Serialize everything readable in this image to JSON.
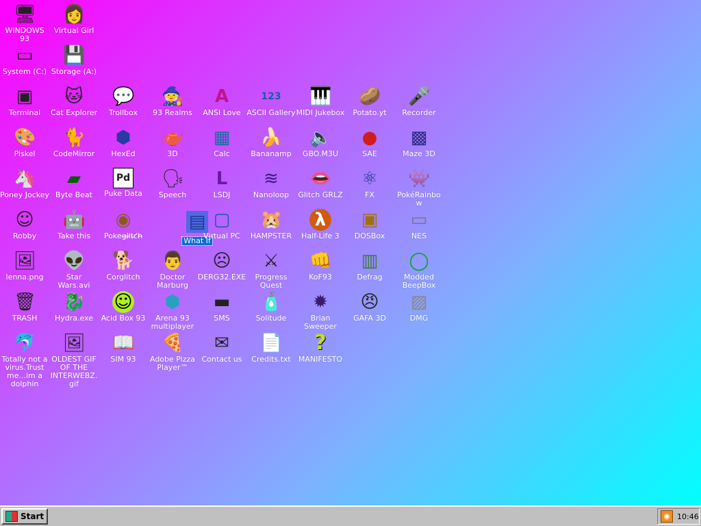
{
  "desktop": {
    "icons": [
      {
        "id": "windows93",
        "label": "WINDOWS 93",
        "glyph": "🖥"
      },
      {
        "id": "virtual-girl",
        "label": "Virtual Girl",
        "glyph": "👩"
      },
      {
        "id": "system-c",
        "label": "System (C:)",
        "glyph": "▭"
      },
      {
        "id": "storage-a",
        "label": "Storage (A:)",
        "glyph": "💾"
      },
      {
        "id": "terminal",
        "label": "Terminal",
        "glyph": "▣"
      },
      {
        "id": "cat-explorer",
        "label": "Cat Explorer",
        "glyph": "🐱"
      },
      {
        "id": "trollbox",
        "label": "Trollbox",
        "glyph": "💬"
      },
      {
        "id": "93-realms",
        "label": "93 Realms",
        "glyph": "🧙"
      },
      {
        "id": "ansi-love",
        "label": "ANSI Love",
        "glyph": "A"
      },
      {
        "id": "ascii-gallery",
        "label": "ASCII Gallery",
        "glyph": "123"
      },
      {
        "id": "midi-jukebox",
        "label": "MIDI Jukebox",
        "glyph": "🎹"
      },
      {
        "id": "potato-yt",
        "label": "Potato.yt",
        "glyph": "🥔"
      },
      {
        "id": "recorder",
        "label": "Recorder",
        "glyph": "🎤"
      },
      {
        "id": "piskel",
        "label": "Piskel",
        "glyph": "🎨"
      },
      {
        "id": "codemirror",
        "label": "CodeMirror",
        "glyph": "🐈"
      },
      {
        "id": "hexed",
        "label": "HexEd",
        "glyph": "⬢"
      },
      {
        "id": "3d",
        "label": "3D",
        "glyph": "🫖"
      },
      {
        "id": "calc",
        "label": "Calc",
        "glyph": "▦"
      },
      {
        "id": "bananamp",
        "label": "Bananamp",
        "glyph": "🍌"
      },
      {
        "id": "gbo-m3u",
        "label": "GBO.M3U",
        "glyph": "🔈"
      },
      {
        "id": "sae",
        "label": "SAE",
        "glyph": "●"
      },
      {
        "id": "maze-3d",
        "label": "Maze 3D",
        "glyph": "▩"
      },
      {
        "id": "poney-jockey",
        "label": "Poney Jockey",
        "glyph": "🦄"
      },
      {
        "id": "byte-beat",
        "label": "Byte Beat",
        "glyph": "▰"
      },
      {
        "id": "puke-data",
        "label": "Puke Data",
        "glyph": "Pd"
      },
      {
        "id": "speech",
        "label": "Speech",
        "glyph": "🗣"
      },
      {
        "id": "lsdj",
        "label": "LSDJ",
        "glyph": "L"
      },
      {
        "id": "nanoloop",
        "label": "Nanoloop",
        "glyph": "≋"
      },
      {
        "id": "glitch-grlz",
        "label": "Glitch GRLZ",
        "glyph": "👄"
      },
      {
        "id": "fx",
        "label": "FX",
        "glyph": "⚛"
      },
      {
        "id": "pokerainbow",
        "label": "PokéRainbow",
        "glyph": "👾"
      },
      {
        "id": "robby",
        "label": "Robby",
        "glyph": "☺"
      },
      {
        "id": "take-this",
        "label": "Take this",
        "glyph": "🤖"
      },
      {
        "id": "pokegl",
        "label": "Pokeg̶l̴i̷t̵c̸h̶",
        "glyph": "◉"
      },
      {
        "id": "what-if",
        "label": "What If",
        "glyph": "▤"
      },
      {
        "id": "virtual-pc",
        "label": "Virtual PC",
        "glyph": "▢"
      },
      {
        "id": "hampster",
        "label": "HAMPSTER",
        "glyph": "🐹"
      },
      {
        "id": "half-life-3",
        "label": "Half-Life 3",
        "glyph": "λ"
      },
      {
        "id": "dosbox",
        "label": "DOSBox",
        "glyph": "▣"
      },
      {
        "id": "nes",
        "label": "NES",
        "glyph": "▭"
      },
      {
        "id": "lenna-png",
        "label": "lenna.png",
        "glyph": "🖼"
      },
      {
        "id": "star-wars-avi",
        "label": "Star Wars.avi",
        "glyph": "👽"
      },
      {
        "id": "corglitch",
        "label": "Corglitch",
        "glyph": "🐕"
      },
      {
        "id": "doctor-marburg",
        "label": "Doctor Marburg",
        "glyph": "👨"
      },
      {
        "id": "derg32-exe",
        "label": "DERG32.EXE",
        "glyph": "☹"
      },
      {
        "id": "progress-quest",
        "label": "Progress Quest",
        "glyph": "⚔"
      },
      {
        "id": "kof93",
        "label": "KoF93",
        "glyph": "👊"
      },
      {
        "id": "defrag",
        "label": "Defrag",
        "glyph": "▥"
      },
      {
        "id": "modded-beepbox",
        "label": "Modded BeepBox",
        "glyph": "◯"
      },
      {
        "id": "trash",
        "label": "TRASH",
        "glyph": "🗑"
      },
      {
        "id": "hydra-exe",
        "label": "Hydra.exe",
        "glyph": "🐉"
      },
      {
        "id": "acid-box-93",
        "label": "Acid Box 93",
        "glyph": "☺"
      },
      {
        "id": "arena-93",
        "label": "Arena 93 multiplayer",
        "glyph": "⬢"
      },
      {
        "id": "sms",
        "label": "SMS",
        "glyph": "▬"
      },
      {
        "id": "solitude",
        "label": "Solitude",
        "glyph": "🧴"
      },
      {
        "id": "brian-sweeper",
        "label": "Brian Sweeper",
        "glyph": "✹"
      },
      {
        "id": "gafa-3d",
        "label": "GAFA 3D",
        "glyph": "😠"
      },
      {
        "id": "dmg",
        "label": "DMG",
        "glyph": "▨"
      },
      {
        "id": "dolphin",
        "label": "Totally not a virus.Trust me...im a dolphin",
        "glyph": "🐬"
      },
      {
        "id": "oldest-gif",
        "label": "OLDEST GIF OF THE INTERWEBZ.gif",
        "glyph": "🖼"
      },
      {
        "id": "sim93",
        "label": "SIM 93",
        "glyph": "📖"
      },
      {
        "id": "adobe-pizza",
        "label": "Adobe Pizza Player™",
        "glyph": "🍕"
      },
      {
        "id": "contact-us",
        "label": "Contact us",
        "glyph": "✉"
      },
      {
        "id": "credits-txt",
        "label": "Credits.txt",
        "glyph": "📄"
      },
      {
        "id": "manifesto",
        "label": "MANIFESTO",
        "glyph": "?"
      }
    ]
  },
  "taskbar": {
    "start_label": "Start",
    "clock": "10:46"
  }
}
